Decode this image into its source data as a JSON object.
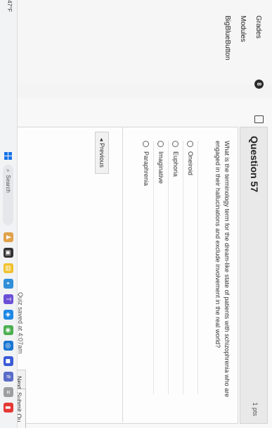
{
  "nav": {
    "items": [
      "Grades",
      "Modules",
      "BigBlueButton"
    ],
    "badge": "8"
  },
  "question": {
    "title": "Question 57",
    "points": "1 pts",
    "text": "What is the terminology term for the dream-like state of patients with schizophrenia who are engaged in their hallucinations and exclude involvement in the real world?",
    "options": [
      "Oneiroid",
      "Euphoria",
      "Imaginative",
      "Paraphrenia"
    ]
  },
  "buttons": {
    "previous": "◂ Previous",
    "next": "Next ▸",
    "submit": "Submit Qu"
  },
  "status": {
    "saved": "Quiz saved at 4:07am"
  },
  "taskbar": {
    "left_text": "47°F",
    "search": "Search"
  },
  "colors": {
    "accent": "#c94b3b",
    "windows": "#1a73e8"
  }
}
